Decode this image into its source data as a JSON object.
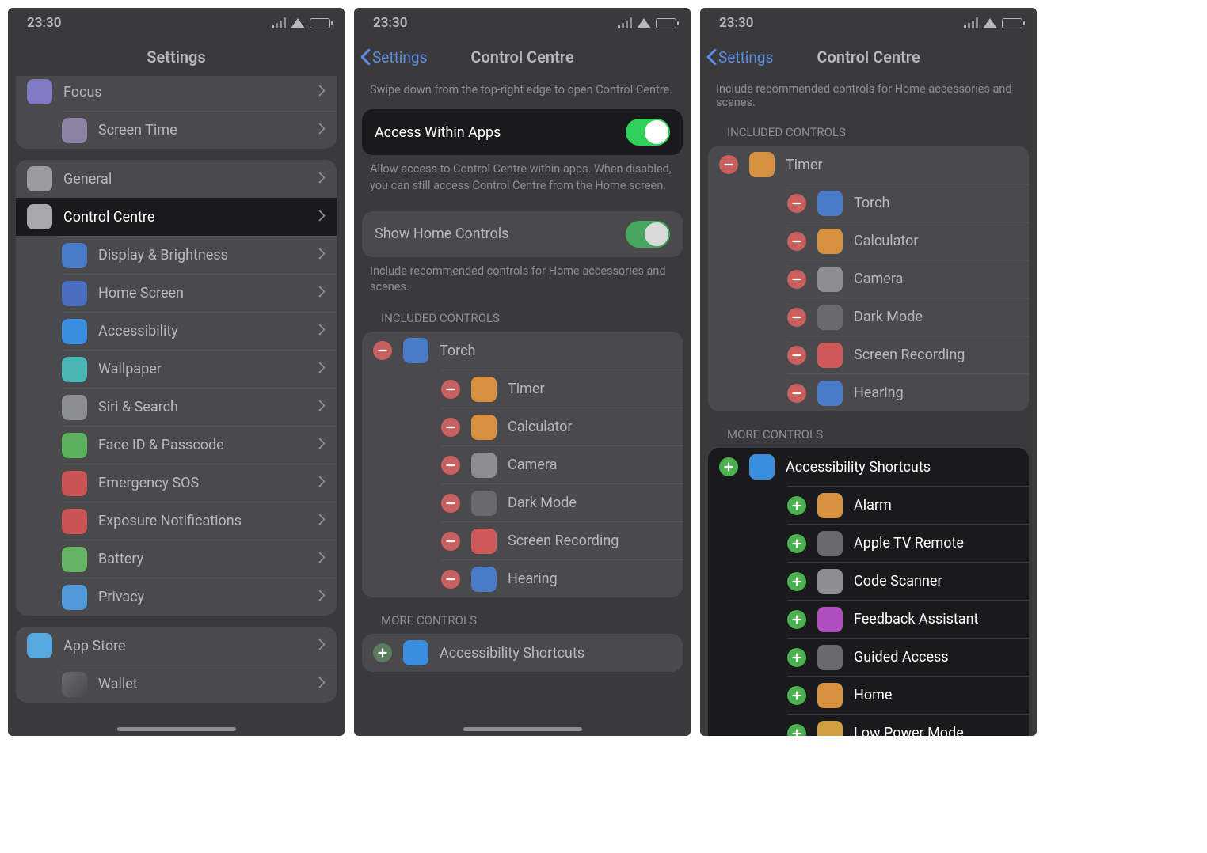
{
  "status": {
    "time": "23:30"
  },
  "p1": {
    "nav_title": "Settings",
    "groups": [
      {
        "partial": true,
        "rows": [
          {
            "name": "focus",
            "label": "Focus",
            "iconClass": "ic-focus"
          },
          {
            "name": "screen-time",
            "label": "Screen Time",
            "iconClass": "ic-st"
          }
        ]
      },
      {
        "rows": [
          {
            "name": "general",
            "label": "General",
            "iconClass": "ic-gen"
          },
          {
            "name": "control-centre",
            "label": "Control Centre",
            "iconClass": "ic-cc",
            "highlight": true
          },
          {
            "name": "display-brightness",
            "label": "Display & Brightness",
            "iconClass": "ic-db"
          },
          {
            "name": "home-screen",
            "label": "Home Screen",
            "iconClass": "ic-hs"
          },
          {
            "name": "accessibility",
            "label": "Accessibility",
            "iconClass": "ic-acc"
          },
          {
            "name": "wallpaper",
            "label": "Wallpaper",
            "iconClass": "ic-wall"
          },
          {
            "name": "siri-search",
            "label": "Siri & Search",
            "iconClass": "ic-siri"
          },
          {
            "name": "face-id-passcode",
            "label": "Face ID & Passcode",
            "iconClass": "ic-fid"
          },
          {
            "name": "emergency-sos",
            "label": "Emergency SOS",
            "iconClass": "ic-sos"
          },
          {
            "name": "exposure-notifications",
            "label": "Exposure Notifications",
            "iconClass": "ic-exp"
          },
          {
            "name": "battery",
            "label": "Battery",
            "iconClass": "ic-bat"
          },
          {
            "name": "privacy",
            "label": "Privacy",
            "iconClass": "ic-priv"
          }
        ]
      },
      {
        "rows": [
          {
            "name": "app-store",
            "label": "App Store",
            "iconClass": "ic-as"
          },
          {
            "name": "wallet",
            "label": "Wallet",
            "iconClass": "ic-wal"
          }
        ]
      }
    ]
  },
  "p2": {
    "back": "Settings",
    "nav_title": "Control Centre",
    "intro": "Swipe down from the top-right edge to open Control Centre.",
    "access_label": "Access Within Apps",
    "access_desc": "Allow access to Control Centre within apps. When disabled, you can still access Control Centre from the Home screen.",
    "home_label": "Show Home Controls",
    "home_desc": "Include recommended controls for Home accessories and scenes.",
    "included_header": "INCLUDED CONTROLS",
    "included": [
      {
        "name": "torch",
        "label": "Torch",
        "iconClass": "ci-torch"
      },
      {
        "name": "timer",
        "label": "Timer",
        "iconClass": "ci-timer"
      },
      {
        "name": "calculator",
        "label": "Calculator",
        "iconClass": "ci-calc"
      },
      {
        "name": "camera",
        "label": "Camera",
        "iconClass": "ci-cam"
      },
      {
        "name": "dark-mode",
        "label": "Dark Mode",
        "iconClass": "ci-dm"
      },
      {
        "name": "screen-recording",
        "label": "Screen Recording",
        "iconClass": "ci-rec"
      },
      {
        "name": "hearing",
        "label": "Hearing",
        "iconClass": "ci-hear"
      }
    ],
    "more_header": "MORE CONTROLS",
    "more": [
      {
        "name": "accessibility-shortcuts",
        "label": "Accessibility Shortcuts",
        "iconClass": "ci-accs"
      }
    ]
  },
  "p3": {
    "back": "Settings",
    "nav_title": "Control Centre",
    "top_partial_desc": "Include recommended controls for Home accessories and scenes.",
    "included_header": "INCLUDED CONTROLS",
    "included": [
      {
        "name": "timer",
        "label": "Timer",
        "iconClass": "ci-timer"
      },
      {
        "name": "torch",
        "label": "Torch",
        "iconClass": "ci-torch"
      },
      {
        "name": "calculator",
        "label": "Calculator",
        "iconClass": "ci-calc"
      },
      {
        "name": "camera",
        "label": "Camera",
        "iconClass": "ci-cam"
      },
      {
        "name": "dark-mode",
        "label": "Dark Mode",
        "iconClass": "ci-dm"
      },
      {
        "name": "screen-recording",
        "label": "Screen Recording",
        "iconClass": "ci-rec"
      },
      {
        "name": "hearing",
        "label": "Hearing",
        "iconClass": "ci-hear"
      }
    ],
    "more_header": "MORE CONTROLS",
    "more": [
      {
        "name": "accessibility-shortcuts",
        "label": "Accessibility Shortcuts",
        "iconClass": "ci-accs"
      },
      {
        "name": "alarm",
        "label": "Alarm",
        "iconClass": "ci-alarm"
      },
      {
        "name": "apple-tv-remote",
        "label": "Apple TV Remote",
        "iconClass": "ci-atv"
      },
      {
        "name": "code-scanner",
        "label": "Code Scanner",
        "iconClass": "ci-qr"
      },
      {
        "name": "feedback-assistant",
        "label": "Feedback Assistant",
        "iconClass": "ci-fb"
      },
      {
        "name": "guided-access",
        "label": "Guided Access",
        "iconClass": "ci-ga"
      },
      {
        "name": "home",
        "label": "Home",
        "iconClass": "ci-home"
      },
      {
        "name": "low-power-mode",
        "label": "Low Power Mode",
        "iconClass": "ci-lpm"
      }
    ]
  }
}
